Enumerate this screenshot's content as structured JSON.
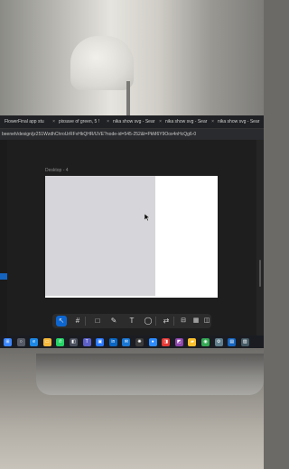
{
  "browser": {
    "tabs": [
      {
        "label": "FlowerFinal app stu"
      },
      {
        "label": "pixsave of green, 5 !"
      },
      {
        "label": "nika show svg - Sear"
      },
      {
        "label": "nika show svg - Sear"
      },
      {
        "label": "nika show svg - Sear"
      }
    ],
    "address": "beeneh/design/jz251WzdhChroUrRFvHkQHR/UVE?node-id=545-252&t=PkM6Y9Oox4nHcQg6-0"
  },
  "canvas": {
    "frame_label": "Desktop - 4"
  },
  "left_panel": {
    "items": [
      "",
      "",
      "",
      "",
      "",
      ""
    ]
  },
  "toolbar": {
    "tools": [
      {
        "name": "move-tool",
        "glyph": "↖",
        "active": true
      },
      {
        "name": "frame-tool",
        "glyph": "#"
      },
      {
        "name": "shape-tool",
        "glyph": "□"
      },
      {
        "name": "pen-tool",
        "glyph": "✎"
      },
      {
        "name": "text-tool",
        "glyph": "T"
      },
      {
        "name": "comment-tool",
        "glyph": "◯"
      },
      {
        "name": "actions-tool",
        "glyph": "⇄"
      },
      {
        "name": "dev-mode-toggle",
        "glyph": "⊟"
      },
      {
        "name": "panel-toggle",
        "glyph": "▦"
      },
      {
        "name": "share-toggle",
        "glyph": "◫"
      }
    ]
  },
  "taskbar": {
    "icons": [
      {
        "name": "start-icon",
        "glyph": "⊞",
        "color": "#3a86ff"
      },
      {
        "name": "search-icon",
        "glyph": "○",
        "color": "#555a66"
      },
      {
        "name": "edge-icon",
        "glyph": "e",
        "color": "#1e88e5"
      },
      {
        "name": "explorer-icon",
        "glyph": "▭",
        "color": "#f6b93b"
      },
      {
        "name": "whatsapp-icon",
        "glyph": "✆",
        "color": "#25d366"
      },
      {
        "name": "app-icon",
        "glyph": "◧",
        "color": "#4a4f5c"
      },
      {
        "name": "teams-icon",
        "glyph": "T",
        "color": "#5b5fc7"
      },
      {
        "name": "store-icon",
        "glyph": "▣",
        "color": "#2979ff"
      },
      {
        "name": "linkedin-icon",
        "glyph": "in",
        "color": "#0a66c2"
      },
      {
        "name": "mail-icon",
        "glyph": "✉",
        "color": "#1976d2"
      },
      {
        "name": "chatgpt-icon",
        "glyph": "✺",
        "color": "#3b3b3b"
      },
      {
        "name": "zoom-icon",
        "glyph": "●",
        "color": "#2d8cff"
      },
      {
        "name": "app2-icon",
        "glyph": "◨",
        "color": "#e53935"
      },
      {
        "name": "photos-icon",
        "glyph": "◩",
        "color": "#8e44ad"
      },
      {
        "name": "folder-icon",
        "glyph": "▰",
        "color": "#fbc02d"
      },
      {
        "name": "chrome-icon",
        "glyph": "◉",
        "color": "#34a853"
      },
      {
        "name": "settings-icon",
        "glyph": "⚙",
        "color": "#607d8b"
      },
      {
        "name": "app3-icon",
        "glyph": "▤",
        "color": "#1565c0"
      },
      {
        "name": "app4-icon",
        "glyph": "▨",
        "color": "#455a64"
      }
    ]
  }
}
